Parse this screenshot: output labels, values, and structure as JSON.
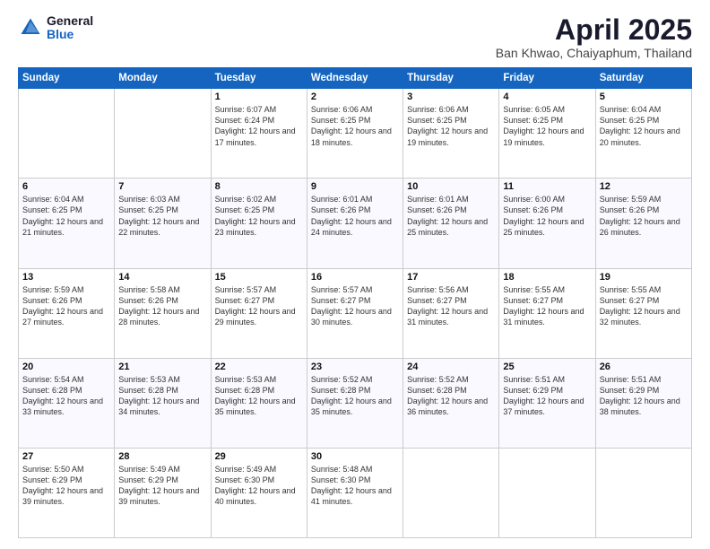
{
  "header": {
    "logo_general": "General",
    "logo_blue": "Blue",
    "title": "April 2025",
    "location": "Ban Khwao, Chaiyaphum, Thailand"
  },
  "days_of_week": [
    "Sunday",
    "Monday",
    "Tuesday",
    "Wednesday",
    "Thursday",
    "Friday",
    "Saturday"
  ],
  "weeks": [
    [
      {
        "day": "",
        "info": ""
      },
      {
        "day": "",
        "info": ""
      },
      {
        "day": "1",
        "info": "Sunrise: 6:07 AM\nSunset: 6:24 PM\nDaylight: 12 hours and 17 minutes."
      },
      {
        "day": "2",
        "info": "Sunrise: 6:06 AM\nSunset: 6:25 PM\nDaylight: 12 hours and 18 minutes."
      },
      {
        "day": "3",
        "info": "Sunrise: 6:06 AM\nSunset: 6:25 PM\nDaylight: 12 hours and 19 minutes."
      },
      {
        "day": "4",
        "info": "Sunrise: 6:05 AM\nSunset: 6:25 PM\nDaylight: 12 hours and 19 minutes."
      },
      {
        "day": "5",
        "info": "Sunrise: 6:04 AM\nSunset: 6:25 PM\nDaylight: 12 hours and 20 minutes."
      }
    ],
    [
      {
        "day": "6",
        "info": "Sunrise: 6:04 AM\nSunset: 6:25 PM\nDaylight: 12 hours and 21 minutes."
      },
      {
        "day": "7",
        "info": "Sunrise: 6:03 AM\nSunset: 6:25 PM\nDaylight: 12 hours and 22 minutes."
      },
      {
        "day": "8",
        "info": "Sunrise: 6:02 AM\nSunset: 6:25 PM\nDaylight: 12 hours and 23 minutes."
      },
      {
        "day": "9",
        "info": "Sunrise: 6:01 AM\nSunset: 6:26 PM\nDaylight: 12 hours and 24 minutes."
      },
      {
        "day": "10",
        "info": "Sunrise: 6:01 AM\nSunset: 6:26 PM\nDaylight: 12 hours and 25 minutes."
      },
      {
        "day": "11",
        "info": "Sunrise: 6:00 AM\nSunset: 6:26 PM\nDaylight: 12 hours and 25 minutes."
      },
      {
        "day": "12",
        "info": "Sunrise: 5:59 AM\nSunset: 6:26 PM\nDaylight: 12 hours and 26 minutes."
      }
    ],
    [
      {
        "day": "13",
        "info": "Sunrise: 5:59 AM\nSunset: 6:26 PM\nDaylight: 12 hours and 27 minutes."
      },
      {
        "day": "14",
        "info": "Sunrise: 5:58 AM\nSunset: 6:26 PM\nDaylight: 12 hours and 28 minutes."
      },
      {
        "day": "15",
        "info": "Sunrise: 5:57 AM\nSunset: 6:27 PM\nDaylight: 12 hours and 29 minutes."
      },
      {
        "day": "16",
        "info": "Sunrise: 5:57 AM\nSunset: 6:27 PM\nDaylight: 12 hours and 30 minutes."
      },
      {
        "day": "17",
        "info": "Sunrise: 5:56 AM\nSunset: 6:27 PM\nDaylight: 12 hours and 31 minutes."
      },
      {
        "day": "18",
        "info": "Sunrise: 5:55 AM\nSunset: 6:27 PM\nDaylight: 12 hours and 31 minutes."
      },
      {
        "day": "19",
        "info": "Sunrise: 5:55 AM\nSunset: 6:27 PM\nDaylight: 12 hours and 32 minutes."
      }
    ],
    [
      {
        "day": "20",
        "info": "Sunrise: 5:54 AM\nSunset: 6:28 PM\nDaylight: 12 hours and 33 minutes."
      },
      {
        "day": "21",
        "info": "Sunrise: 5:53 AM\nSunset: 6:28 PM\nDaylight: 12 hours and 34 minutes."
      },
      {
        "day": "22",
        "info": "Sunrise: 5:53 AM\nSunset: 6:28 PM\nDaylight: 12 hours and 35 minutes."
      },
      {
        "day": "23",
        "info": "Sunrise: 5:52 AM\nSunset: 6:28 PM\nDaylight: 12 hours and 35 minutes."
      },
      {
        "day": "24",
        "info": "Sunrise: 5:52 AM\nSunset: 6:28 PM\nDaylight: 12 hours and 36 minutes."
      },
      {
        "day": "25",
        "info": "Sunrise: 5:51 AM\nSunset: 6:29 PM\nDaylight: 12 hours and 37 minutes."
      },
      {
        "day": "26",
        "info": "Sunrise: 5:51 AM\nSunset: 6:29 PM\nDaylight: 12 hours and 38 minutes."
      }
    ],
    [
      {
        "day": "27",
        "info": "Sunrise: 5:50 AM\nSunset: 6:29 PM\nDaylight: 12 hours and 39 minutes."
      },
      {
        "day": "28",
        "info": "Sunrise: 5:49 AM\nSunset: 6:29 PM\nDaylight: 12 hours and 39 minutes."
      },
      {
        "day": "29",
        "info": "Sunrise: 5:49 AM\nSunset: 6:30 PM\nDaylight: 12 hours and 40 minutes."
      },
      {
        "day": "30",
        "info": "Sunrise: 5:48 AM\nSunset: 6:30 PM\nDaylight: 12 hours and 41 minutes."
      },
      {
        "day": "",
        "info": ""
      },
      {
        "day": "",
        "info": ""
      },
      {
        "day": "",
        "info": ""
      }
    ]
  ]
}
